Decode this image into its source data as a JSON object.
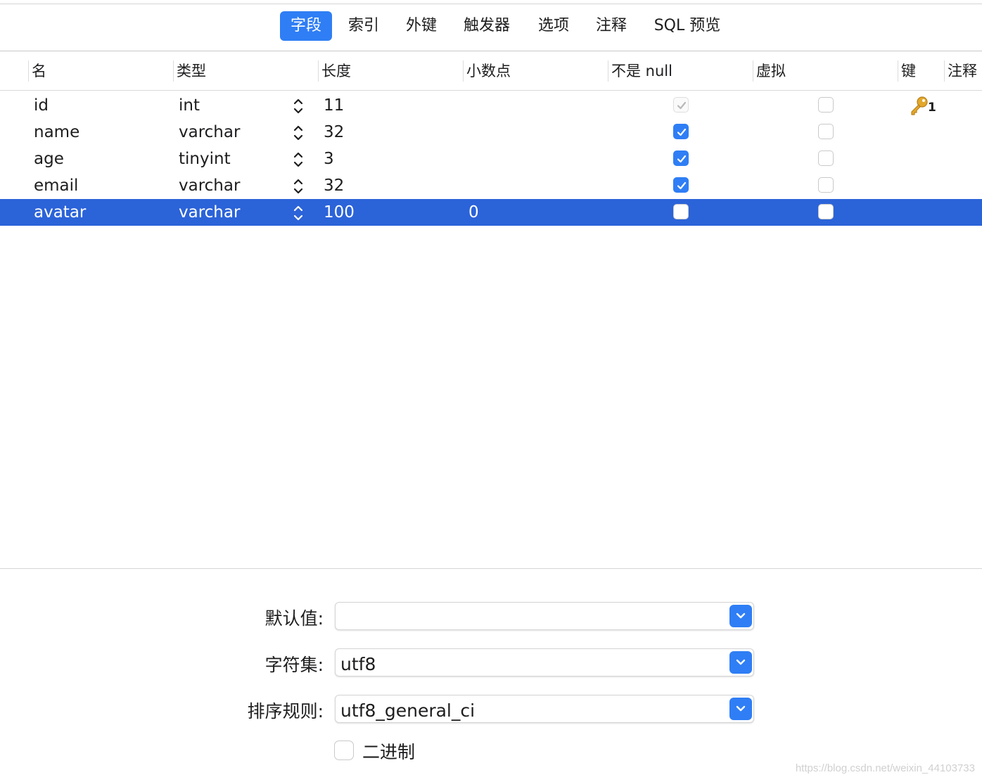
{
  "tabs": [
    {
      "label": "字段",
      "active": true
    },
    {
      "label": "索引",
      "active": false
    },
    {
      "label": "外键",
      "active": false
    },
    {
      "label": "触发器",
      "active": false
    },
    {
      "label": "选项",
      "active": false
    },
    {
      "label": "注释",
      "active": false
    },
    {
      "label": "SQL 预览",
      "active": false
    }
  ],
  "columns": {
    "name": "名",
    "type": "类型",
    "length": "长度",
    "decimals": "小数点",
    "not_null": "不是 null",
    "virtual": "虚拟",
    "key": "键",
    "comment": "注释"
  },
  "rows": [
    {
      "name": "id",
      "type": "int",
      "length": "11",
      "decimals": "",
      "not_null": true,
      "not_null_disabled": true,
      "virtual": false,
      "key": "1",
      "selected": false
    },
    {
      "name": "name",
      "type": "varchar",
      "length": "32",
      "decimals": "",
      "not_null": true,
      "not_null_disabled": false,
      "virtual": false,
      "key": "",
      "selected": false
    },
    {
      "name": "age",
      "type": "tinyint",
      "length": "3",
      "decimals": "",
      "not_null": true,
      "not_null_disabled": false,
      "virtual": false,
      "key": "",
      "selected": false
    },
    {
      "name": "email",
      "type": "varchar",
      "length": "32",
      "decimals": "",
      "not_null": true,
      "not_null_disabled": false,
      "virtual": false,
      "key": "",
      "selected": false
    },
    {
      "name": "avatar",
      "type": "varchar",
      "length": "100",
      "decimals": "0",
      "not_null": false,
      "not_null_disabled": false,
      "virtual": false,
      "key": "",
      "selected": true
    }
  ],
  "form": {
    "default_label": "默认值:",
    "default_value": "",
    "charset_label": "字符集:",
    "charset_value": "utf8",
    "collation_label": "排序规则:",
    "collation_value": "utf8_general_ci",
    "binary_label": "二进制",
    "binary_checked": false
  },
  "icons": {
    "key": "key-icon",
    "stepper": "up-down-stepper-icon",
    "dropdown": "chevron-down-icon"
  },
  "colors": {
    "accent": "#2f7ef5",
    "selection": "#2b63d9",
    "key_gold": "#e3a82b"
  },
  "watermark": "https://blog.csdn.net/weixin_44103733"
}
